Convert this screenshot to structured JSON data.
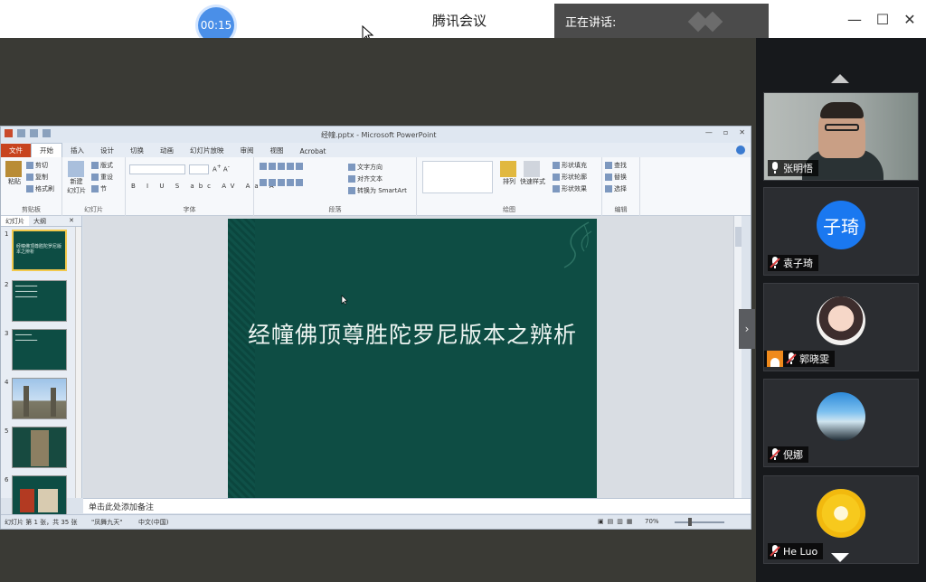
{
  "meeting": {
    "timer": "00:15",
    "title": "腾讯会议",
    "speaking_label": "正在讲话:",
    "window_controls": {
      "minimize": "—",
      "maximize": "☐",
      "close": "✕"
    }
  },
  "powerpoint": {
    "window_title": "经幢.pptx - Microsoft PowerPoint",
    "tabs": [
      "文件",
      "开始",
      "插入",
      "设计",
      "切换",
      "动画",
      "幻灯片放映",
      "审阅",
      "视图",
      "Acrobat"
    ],
    "ribbon": {
      "clipboard": {
        "paste": "粘贴",
        "cut": "剪切",
        "copy": "复制",
        "format_painter": "格式刷",
        "group": "剪贴板"
      },
      "slides": {
        "new_slide": "新建",
        "new_slide_2": "幻灯片",
        "layout": "版式",
        "reset": "重设",
        "section": "节",
        "group": "幻灯片"
      },
      "font": {
        "group": "字体",
        "buttons": [
          "B",
          "I",
          "U",
          "S",
          "abc",
          "AV",
          "Aa",
          "A"
        ]
      },
      "paragraph": {
        "text_direction": "文字方向",
        "align_text": "对齐文本",
        "smartart": "转换为 SmartArt",
        "group": "段落"
      },
      "drawing": {
        "arrange": "排列",
        "quick_styles": "快速样式",
        "shape_fill": "形状填充",
        "shape_outline": "形状轮廓",
        "shape_effects": "形状效果",
        "group": "绘图"
      },
      "editing": {
        "find": "查找",
        "replace": "替换",
        "select": "选择",
        "group": "编辑"
      }
    },
    "side_tabs": {
      "slides": "幻灯片",
      "outline": "大纲",
      "close": "✕"
    },
    "thumbnails": [
      {
        "num": "1",
        "text": "经幢佛顶尊胜陀罗尼版本之辨析"
      },
      {
        "num": "2",
        "text": ""
      },
      {
        "num": "3",
        "text": ""
      },
      {
        "num": "4",
        "text": ""
      },
      {
        "num": "5",
        "text": ""
      },
      {
        "num": "6",
        "text": ""
      }
    ],
    "slide_title": "经幢佛顶尊胜陀罗尼版本之辨析",
    "notes_placeholder": "单击此处添加备注",
    "status": {
      "slide_info": "幻灯片 第 1 张，共 35 张",
      "theme": "\"凤舞九天\"",
      "language": "中文(中国)",
      "zoom": "70%"
    }
  },
  "participants": [
    {
      "name": "张明悟",
      "type": "video",
      "muted": false
    },
    {
      "name": "袁子琦",
      "type": "text-avatar",
      "avatar_text": "子琦",
      "avatar_color": "#1a78f0",
      "muted": true
    },
    {
      "name": "郭晓雯",
      "type": "photo",
      "muted": true,
      "host": true
    },
    {
      "name": "倪娜",
      "type": "photo",
      "muted": true
    },
    {
      "name": "He Luo",
      "type": "photo",
      "muted": true
    }
  ],
  "colors": {
    "accent": "#4a8fe8",
    "slide_bg": "#0e4d44",
    "panel_bg": "#17191c",
    "file_tab": "#c8441f"
  },
  "icons": [
    "cursor-icon",
    "minimize-icon",
    "maximize-icon",
    "close-icon",
    "microphone-icon",
    "muted-microphone-icon",
    "host-icon",
    "chevron-up-icon",
    "chevron-down-icon",
    "chevron-right-icon"
  ]
}
